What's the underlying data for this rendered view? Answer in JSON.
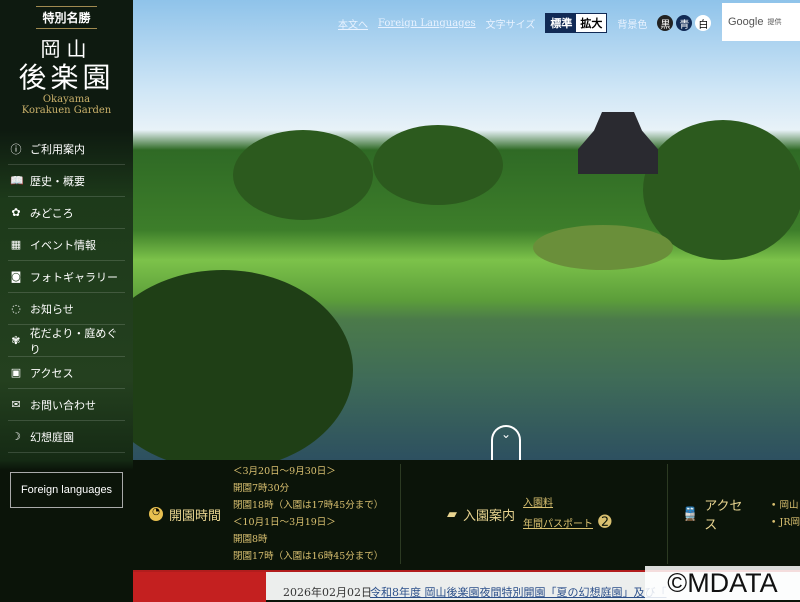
{
  "logo": {
    "badge": "特別名勝",
    "line1": "岡山",
    "line2": "後楽園",
    "en1": "Okayama",
    "en2": "Korakuen Garden"
  },
  "nav": [
    {
      "label": "ご利用案内",
      "icon": "ⓘ"
    },
    {
      "label": "歴史・概要",
      "icon": "📖"
    },
    {
      "label": "みどころ",
      "icon": "✿"
    },
    {
      "label": "イベント情報",
      "icon": "▦"
    },
    {
      "label": "フォトギャラリー",
      "icon": "◙"
    },
    {
      "label": "お知らせ",
      "icon": "◌"
    },
    {
      "label": "花だより・庭めぐり",
      "icon": "✾"
    },
    {
      "label": "アクセス",
      "icon": "▣"
    },
    {
      "label": "お問い合わせ",
      "icon": "✉"
    },
    {
      "label": "幻想庭園",
      "icon": "☽"
    }
  ],
  "foreign_button": "Foreign languages",
  "topbar": {
    "to_main": "本文へ",
    "foreign": "Foreign Languages",
    "font_size_label": "文字サイズ",
    "size_standard": "標準",
    "size_large": "拡大",
    "bg_label": "背景色",
    "bg_black": "黒",
    "bg_blue": "青",
    "bg_white": "白",
    "google": "Google",
    "google_sub": "提供"
  },
  "hours": {
    "title": "開園時間",
    "period1": "＜3月20日～9月30日＞",
    "open1": "開園7時30分",
    "close1": "閉園18時（入園は17時45分まで）",
    "period2": "＜10月1日～3月19日＞",
    "open2": "開園8時",
    "close2": "閉園17時（入園は16時45分まで）"
  },
  "admission": {
    "title": "入園案内",
    "fee": "入園料",
    "pass": "年間パスポート"
  },
  "access": {
    "title": "アクセス",
    "items": [
      "岡山",
      "JR岡"
    ]
  },
  "news": {
    "date": "2026年02月02日",
    "title": "令和8年度 岡山後楽園夜間特別開園「夏の幻想庭園」及び「"
  },
  "watermark": "©MDATA"
}
